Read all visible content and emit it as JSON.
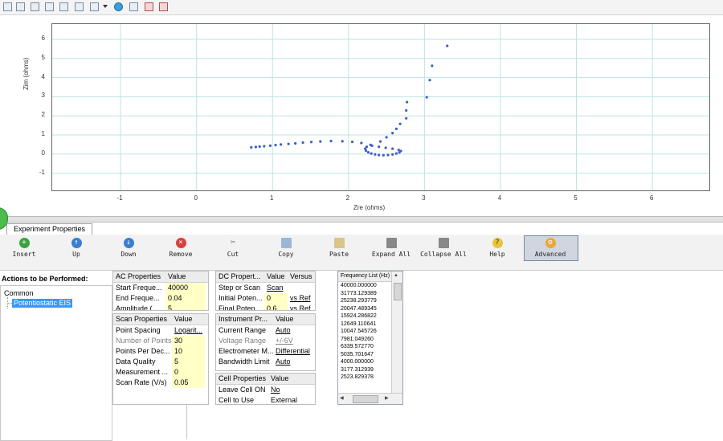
{
  "chart_data": {
    "type": "scatter",
    "xlabel": "Zre (ohms)",
    "ylabel": "Zim (ohms)",
    "xlim": [
      -1.9,
      6.75
    ],
    "ylim": [
      -1.9,
      6.8
    ],
    "x_ticks": [
      "-1",
      "0",
      "1",
      "2",
      "3",
      "4",
      "5",
      "6"
    ],
    "y_ticks": [
      "-1",
      "0",
      "1",
      "2",
      "3",
      "4",
      "5",
      "6"
    ],
    "grid": true,
    "marker_color": "#3a5fc8",
    "series": [
      {
        "x": [
          0.72,
          0.78,
          0.83,
          0.89,
          0.97,
          1.04,
          1.11,
          1.21,
          1.3,
          1.4,
          1.51,
          1.63,
          1.77,
          1.92,
          2.05,
          2.17,
          2.29,
          2.24,
          2.22,
          2.23,
          2.26,
          2.3,
          2.35,
          2.4,
          2.46,
          2.52,
          2.58,
          2.63,
          2.67,
          2.69,
          2.66,
          2.58,
          2.49,
          2.4,
          2.31,
          2.42,
          2.5,
          2.58,
          2.63,
          2.68,
          2.76,
          2.76,
          2.77,
          3.03,
          3.07,
          3.1,
          3.3
        ],
        "y": [
          0.35,
          0.37,
          0.39,
          0.41,
          0.44,
          0.47,
          0.5,
          0.53,
          0.56,
          0.6,
          0.63,
          0.66,
          0.68,
          0.67,
          0.64,
          0.58,
          0.48,
          0.38,
          0.28,
          0.18,
          0.09,
          0.03,
          -0.02,
          -0.05,
          -0.06,
          -0.05,
          -0.02,
          0.03,
          0.09,
          0.16,
          0.22,
          0.28,
          0.33,
          0.38,
          0.44,
          0.66,
          0.88,
          1.1,
          1.32,
          1.58,
          1.87,
          2.28,
          2.72,
          2.97,
          3.87,
          4.62,
          5.66
        ]
      }
    ]
  },
  "ribbon": {
    "insert": "Insert",
    "up": "Up",
    "down": "Down",
    "remove": "Remove",
    "cut": "Cut",
    "copy": "Copy",
    "paste": "Paste",
    "expand_all": "Expand All",
    "collapse_all": "Collapse All",
    "help": "Help",
    "advanced": "Advanced"
  },
  "tabs": {
    "experiment": "Experiment Properties"
  },
  "tree": {
    "header": "Actions to be Performed:",
    "root": "Common",
    "child": "Potentiostatic EIS"
  },
  "ac": {
    "h1": "AC Properties",
    "h2": "Value",
    "rows": [
      {
        "name": "Start Freque...",
        "value": "40000"
      },
      {
        "name": "End Freque...",
        "value": "0.04"
      },
      {
        "name": "Amplitude (...",
        "value": "5"
      }
    ]
  },
  "scan": {
    "h1": "Scan Properties",
    "h2": "Value",
    "rows": [
      {
        "name": "Point Spacing",
        "value": "Logarit..."
      },
      {
        "name": "Number of Points",
        "value": "30"
      },
      {
        "name": "Points Per Dec...",
        "value": "10"
      },
      {
        "name": "Data Quality",
        "value": "5"
      },
      {
        "name": "Measurement ...",
        "value": "0"
      },
      {
        "name": "Scan Rate (V/s)",
        "value": "0.05"
      }
    ]
  },
  "dc": {
    "h1": "DC Propert...",
    "h2": "Value",
    "h3": "Versus",
    "rows": [
      {
        "name": "Step or Scan",
        "value": "Scan",
        "versus": ""
      },
      {
        "name": "Initial Poten...",
        "value": "0",
        "versus": "vs Ref"
      },
      {
        "name": "Final Poten...",
        "value": "0.6",
        "versus": "vs Ref"
      }
    ]
  },
  "instrument": {
    "h1": "Instrument Pr...",
    "h2": "Value",
    "rows": [
      {
        "name": "Current Range",
        "value": "Auto"
      },
      {
        "name": "Voltage Range",
        "value": "+/-6V"
      },
      {
        "name": "Electrometer M...",
        "value": "Differential"
      },
      {
        "name": "Bandwidth Limit",
        "value": "Auto"
      }
    ]
  },
  "cell": {
    "h1": "Cell Properties",
    "h2": "Value",
    "rows": [
      {
        "name": "Leave Cell ON",
        "value": "No"
      },
      {
        "name": "Cell to Use",
        "value": "External"
      }
    ]
  },
  "freq": {
    "header": "Frequency List (Hz)",
    "items": [
      "40000.000000",
      "31773.129389",
      "25238.293779",
      "20047.489345",
      "15924.286822",
      "12649.110641",
      "10047.545726",
      "7981.049260",
      "6339.572770",
      "5035.701647",
      "4000.000000",
      "3177.312939",
      "2523.829378"
    ]
  }
}
